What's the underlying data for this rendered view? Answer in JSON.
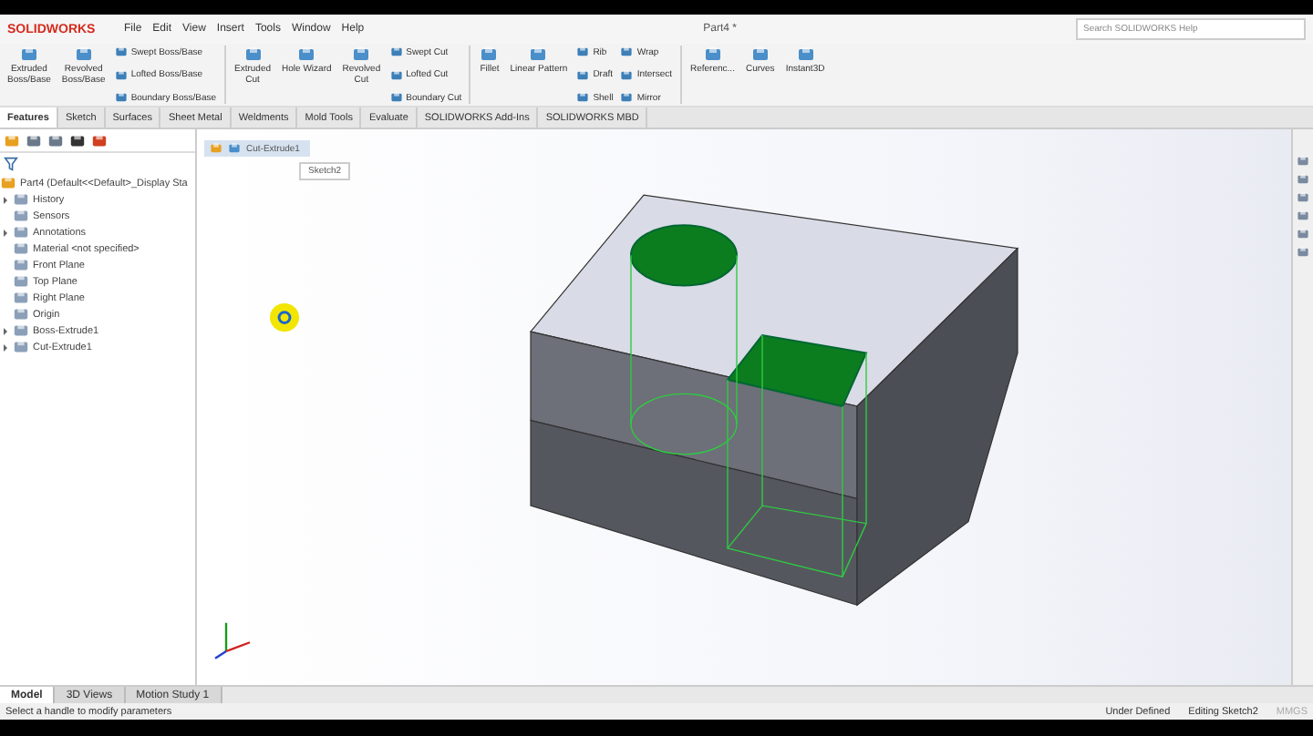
{
  "window": {
    "logo": "SOLIDWORKS",
    "menu": [
      "File",
      "Edit",
      "View",
      "Insert",
      "Tools",
      "Window",
      "Help"
    ],
    "title": "Part4 *",
    "search": {
      "placeholder": "Search SOLIDWORKS Help"
    }
  },
  "ribbon": [
    {
      "kind": "large",
      "lines": [
        "Extruded",
        "Boss/Base"
      ]
    },
    {
      "kind": "large",
      "lines": [
        "Revolved",
        "Boss/Base"
      ]
    },
    {
      "kind": "stack",
      "items": [
        "Swept Boss/Base",
        "Lofted Boss/Base",
        "Boundary Boss/Base"
      ]
    },
    {
      "kind": "divider"
    },
    {
      "kind": "large",
      "lines": [
        "Extruded",
        "Cut"
      ]
    },
    {
      "kind": "large",
      "lines": [
        "Hole Wizard"
      ]
    },
    {
      "kind": "large",
      "lines": [
        "Revolved",
        "Cut"
      ]
    },
    {
      "kind": "stack",
      "items": [
        "Swept Cut",
        "Lofted Cut",
        "Boundary Cut"
      ]
    },
    {
      "kind": "divider"
    },
    {
      "kind": "large",
      "lines": [
        "Fillet"
      ]
    },
    {
      "kind": "large",
      "lines": [
        "Linear Pattern"
      ]
    },
    {
      "kind": "stack",
      "items": [
        "Rib",
        "Draft",
        "Shell"
      ]
    },
    {
      "kind": "stack",
      "items": [
        "Wrap",
        "Intersect",
        "Mirror"
      ]
    },
    {
      "kind": "divider"
    },
    {
      "kind": "large",
      "lines": [
        "Referenc..."
      ]
    },
    {
      "kind": "large",
      "lines": [
        "Curves"
      ]
    },
    {
      "kind": "large",
      "lines": [
        "Instant3D"
      ]
    }
  ],
  "tabs": [
    {
      "label": "Features",
      "selected": true
    },
    {
      "label": "Sketch",
      "selected": false
    },
    {
      "label": "Surfaces",
      "selected": false
    },
    {
      "label": "Sheet Metal",
      "selected": false
    },
    {
      "label": "Weldments",
      "selected": false
    },
    {
      "label": "Mold Tools",
      "selected": false
    },
    {
      "label": "Evaluate",
      "selected": false
    },
    {
      "label": "SOLIDWORKS Add-Ins",
      "selected": false
    },
    {
      "label": "SOLIDWORKS MBD",
      "selected": false
    }
  ],
  "tree": {
    "root": "Part4  (Default<<Default>_Display Sta",
    "items": [
      {
        "label": "History",
        "expandable": true
      },
      {
        "label": "Sensors",
        "expandable": false
      },
      {
        "label": "Annotations",
        "expandable": true
      },
      {
        "label": "Material <not specified>",
        "expandable": false
      },
      {
        "label": "Front Plane",
        "expandable": false
      },
      {
        "label": "Top Plane",
        "expandable": false
      },
      {
        "label": "Right Plane",
        "expandable": false
      },
      {
        "label": "Origin",
        "expandable": false
      },
      {
        "label": "Boss-Extrude1",
        "expandable": true
      },
      {
        "label": "Cut-Extrude1",
        "expandable": true
      }
    ]
  },
  "breadcrumb": {
    "feature": "Cut-Extrude1",
    "sketch": "Sketch2"
  },
  "bottom_tabs": [
    {
      "label": "Model",
      "selected": true
    },
    {
      "label": "3D Views",
      "selected": false
    },
    {
      "label": "Motion Study 1",
      "selected": false
    }
  ],
  "status_bar": {
    "message": "Select a handle to modify parameters",
    "state": "Under Defined",
    "mode": "Editing Sketch2",
    "units": "MMGS"
  }
}
